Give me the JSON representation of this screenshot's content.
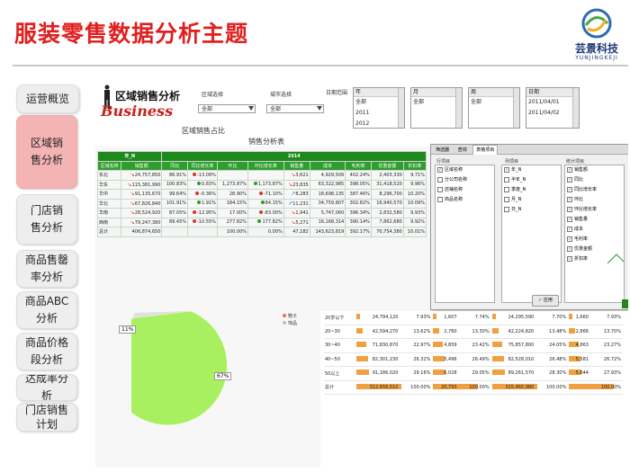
{
  "title": "服装零售数据分析主题",
  "logo": {
    "name": "芸景科技",
    "sub": "YUNJINGKEJI"
  },
  "colors": {
    "title": "#e02020",
    "active_nav": "#f4b4b4",
    "table_header": "#1e8a1e"
  },
  "nav": [
    {
      "label": "运营概览",
      "active": false
    },
    {
      "label": "区域销售分析",
      "active": true
    },
    {
      "label": "门店销售分析",
      "active": false
    },
    {
      "label": "商品售罄率分析",
      "active": false
    },
    {
      "label": "商品ABC分析",
      "active": false
    },
    {
      "label": "商品价格段分析",
      "active": false
    },
    {
      "label": "达成率分析",
      "active": false
    },
    {
      "label": "门店销售计划",
      "active": false
    }
  ],
  "dashboard": {
    "heading": "区域销售分析",
    "brand": "Business",
    "filters": {
      "region_label": "区域选择",
      "region_value": "全部",
      "city_label": "城市选择",
      "city_value": "全部",
      "date_label": "日期范围"
    },
    "date_lists": [
      {
        "header": "年",
        "items": [
          "全部",
          "2011",
          "2012"
        ]
      },
      {
        "header": "月",
        "items": [
          "全部",
          "",
          ""
        ]
      },
      {
        "header": "周",
        "items": [
          "全部",
          "",
          ""
        ]
      },
      {
        "header": "日期",
        "items": [
          "2011/04/01",
          "2011/04/02",
          ""
        ]
      }
    ],
    "ratio_title": "区域销售占比",
    "table_title": "销售分析表",
    "table": {
      "col_group": "年_N",
      "year": "2014",
      "headers": [
        "区域名称",
        "销售额",
        "同比",
        "同比增长率",
        "环比",
        "环比增长率",
        "销售量",
        "成本",
        "毛利率",
        "优惠金额",
        "折扣率"
      ],
      "rows": [
        {
          "name": "东北",
          "sales": "24,757,850",
          "yoy": "86.91%",
          "yoyg": "-13.09%",
          "mom": "",
          "momg": "",
          "qty": "3,621",
          "cost": "4,929,506",
          "margin": "402.24%",
          "disc": "2,403,330",
          "rate": "9.71%",
          "trend": "down"
        },
        {
          "name": "华东",
          "sales": "115,381,990",
          "yoy": "100.83%",
          "yoyg": "0.83%",
          "mom": "1,273.87%",
          "momg": "1,173.87%",
          "qty": "23,835",
          "cost": "63,322,985",
          "margin": "398.05%",
          "disc": "31,418,520",
          "rate": "9.96%",
          "trend": "down"
        },
        {
          "name": "华中",
          "sales": "91,135,670",
          "yoy": "99.64%",
          "yoyg": "-0.36%",
          "mom": "28.90%",
          "momg": "-71.10%",
          "qty": "8,283",
          "cost": "18,698,135",
          "margin": "387.46%",
          "disc": "8,296,700",
          "rate": "10.20%",
          "trend": "up"
        },
        {
          "name": "华北",
          "sales": "67,826,840",
          "yoy": "101.91%",
          "yoyg": "1.91%",
          "mom": "184.15%",
          "momg": "84.15%",
          "qty": "11,231",
          "cost": "34,759,807",
          "margin": "302.82%",
          "disc": "16,940,570",
          "rate": "10.09%",
          "trend": "up"
        },
        {
          "name": "华南",
          "sales": "28,524,920",
          "yoy": "87.05%",
          "yoyg": "-12.95%",
          "mom": "17.00%",
          "momg": "-83.00%",
          "qty": "1,941",
          "cost": "5,747,060",
          "margin": "396.34%",
          "disc": "2,832,580",
          "rate": "9.93%",
          "trend": "down"
        },
        {
          "name": "西南",
          "sales": "79,247,380",
          "yoy": "89.45%",
          "yoyg": "-10.55%",
          "mom": "277.82%",
          "momg": "177.82%",
          "qty": "5,271",
          "cost": "16,168,314",
          "margin": "390.14%",
          "disc": "7,862,680",
          "rate": "9.92%",
          "trend": "down"
        }
      ],
      "total": {
        "name": "总计",
        "sales": "406,874,650",
        "yoy": "",
        "yoyg": "",
        "mom": "100.00%",
        "momg": "0.00%",
        "qty": "47,182",
        "cost": "143,623,819",
        "margin": "392.17%",
        "disc": "70,754,380",
        "rate": "10.01%"
      }
    },
    "dialog": {
      "tabs": [
        "筛选器",
        "查询",
        "表格项目"
      ],
      "row_title": "行项目",
      "col_title": "列项目",
      "stat_title": "统计项目",
      "row_items": [
        {
          "label": "区域名称",
          "checked": true
        },
        {
          "label": "分公司名称",
          "checked": false
        },
        {
          "label": "店铺名称",
          "checked": false
        },
        {
          "label": "商品名称",
          "checked": false
        }
      ],
      "col_items": [
        {
          "label": "年_N",
          "checked": true
        },
        {
          "label": "半年_N",
          "checked": false
        },
        {
          "label": "季度_N",
          "checked": false
        },
        {
          "label": "月_N",
          "checked": false
        },
        {
          "label": "日_N",
          "checked": false
        }
      ],
      "stat_items": [
        {
          "label": "销售额",
          "checked": true
        },
        {
          "label": "同比",
          "checked": true
        },
        {
          "label": "同比增长率",
          "checked": true
        },
        {
          "label": "环比",
          "checked": true
        },
        {
          "label": "环比增长率",
          "checked": true
        },
        {
          "label": "销售量",
          "checked": true
        },
        {
          "label": "成本",
          "checked": true
        },
        {
          "label": "毛利率",
          "checked": true
        },
        {
          "label": "优惠金额",
          "checked": true
        },
        {
          "label": "折扣率",
          "checked": true
        }
      ],
      "apply": "应用"
    },
    "pie": {
      "labels": [
        "11%",
        "67%"
      ],
      "legend": [
        "鞋子",
        "饰品"
      ]
    },
    "age_table": {
      "rows": [
        {
          "name": "20岁以下",
          "a": "24,794,120",
          "b": "7.93%",
          "c": "1,607",
          "d": "7.74%",
          "e": "24,295,590",
          "f": "7.70%",
          "g": "1,660",
          "h": "7.93%",
          "pa": 0.07
        },
        {
          "name": "20~30",
          "a": "42,594,270",
          "b": "13.62%",
          "c": "2,760",
          "d": "13.30%",
          "e": "42,224,820",
          "f": "13.48%",
          "g": "2,866",
          "h": "13.70%",
          "pa": 0.13
        },
        {
          "name": "30~40",
          "a": "71,830,870",
          "b": "22.97%",
          "c": "4,859",
          "d": "23.42%",
          "e": "75,857,800",
          "f": "24.05%",
          "g": "4,863",
          "h": "23.27%",
          "pa": 0.21
        },
        {
          "name": "40~50",
          "a": "82,301,230",
          "b": "26.32%",
          "c": "5,496",
          "d": "26.49%",
          "e": "82,528,010",
          "f": "26.48%",
          "g": "5,581",
          "h": "26.72%",
          "pa": 0.26
        },
        {
          "name": "50以上",
          "a": "91,186,020",
          "b": "29.16%",
          "c": "6,028",
          "d": "29.05%",
          "e": "89,261,570",
          "f": "28.30%",
          "g": "5,644",
          "h": "27.93%",
          "pa": 0.29
        },
        {
          "name": "总计",
          "a": "312,656,510",
          "b": "100.00%",
          "c": "20,750",
          "d": "100.00%",
          "e": "315,465,980",
          "f": "100.00%",
          "g": "",
          "h": "100.00%",
          "pa": 1.0
        }
      ]
    }
  }
}
